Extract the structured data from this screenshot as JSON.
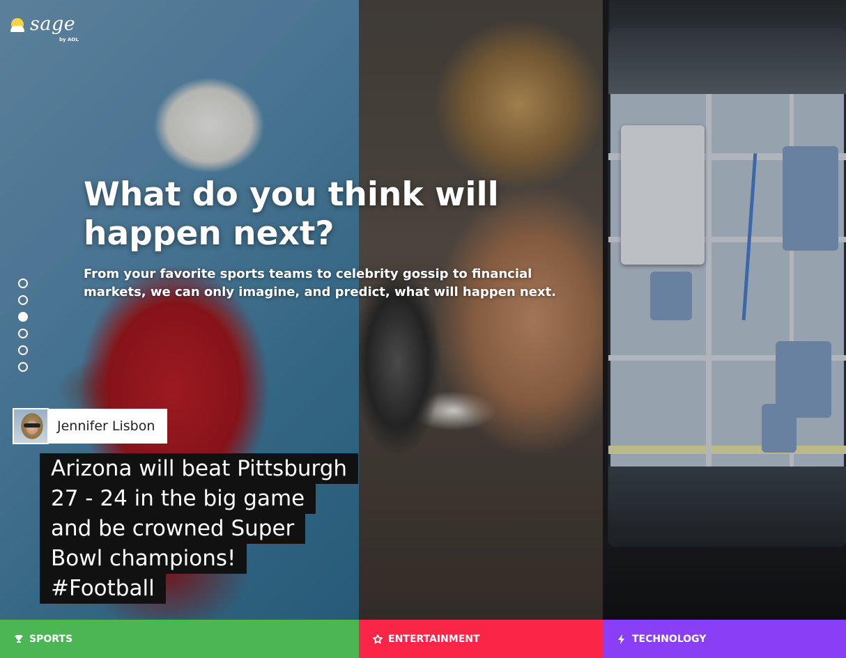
{
  "brand": {
    "name": "sage",
    "byline": "by AOL",
    "logo_color": "#f4d34a"
  },
  "hero": {
    "headline": "What do you think will happen next?",
    "subline": "From your favorite sports teams to celebrity gossip to financial markets, we can only imagine, and predict, what will happen next."
  },
  "slider": {
    "count": 6,
    "active_index": 2
  },
  "prediction": {
    "user_name": "Jennifer Lisbon",
    "text": "Arizona will beat Pittsburgh 27 - 24 in the big game and be crowned Super Bowl champions! #Football"
  },
  "categories": [
    {
      "label": "SPORTS",
      "icon": "trophy-icon",
      "color": "#4cb654"
    },
    {
      "label": "ENTERTAINMENT",
      "icon": "star-icon",
      "color": "#fb2548"
    },
    {
      "label": "TECHNOLOGY",
      "icon": "lightning-icon",
      "color": "#8a3ff6"
    }
  ]
}
